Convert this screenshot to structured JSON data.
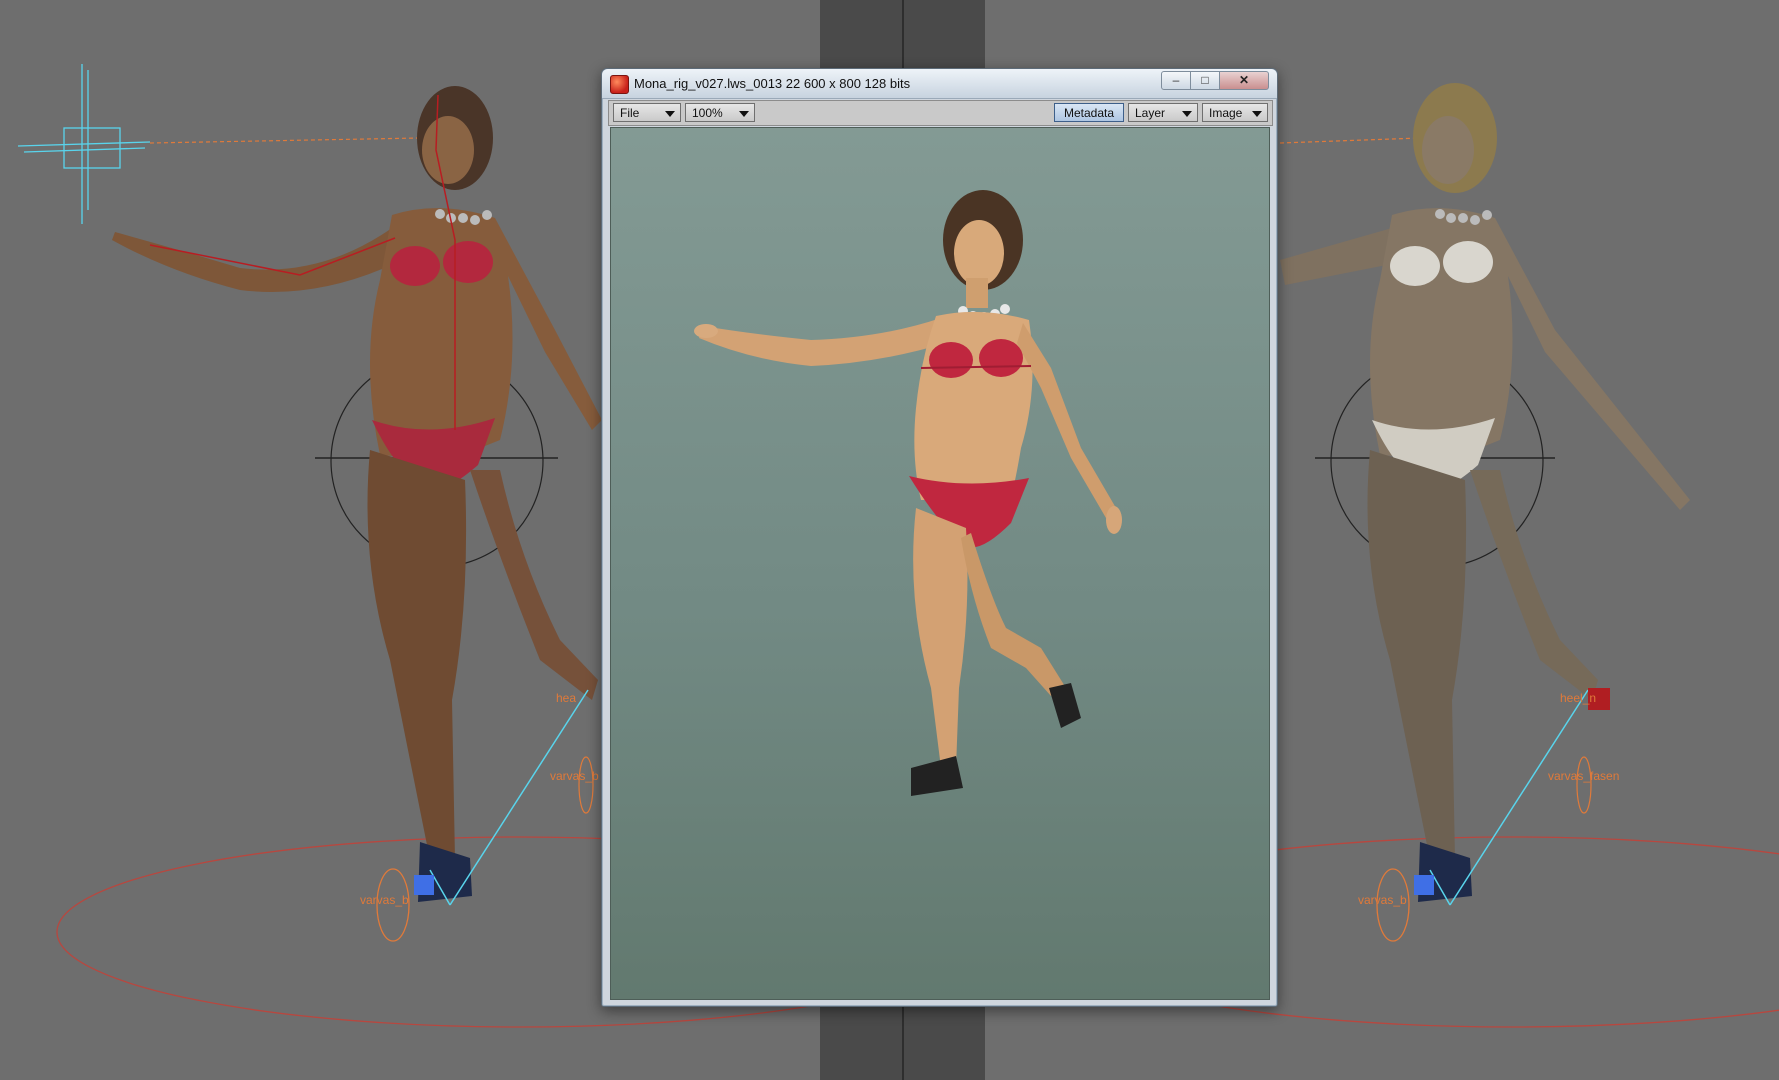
{
  "render_window": {
    "title": "Mona_rig_v027.lws_0013 22  600 x 800 128 bits",
    "minimize_glyph": "–",
    "maximize_glyph": "□",
    "close_glyph": "✕",
    "toolbar": {
      "file_label": "File",
      "zoom_label": "100%",
      "metadata_label": "Metadata",
      "layer_label": "Layer",
      "image_label": "Image"
    }
  },
  "viewport_left": {
    "labels": [
      "hea",
      "varvas_b",
      "varvas_b"
    ]
  },
  "viewport_right": {
    "labels": [
      "heel_n",
      "varvas_fasen",
      "varvas_b"
    ]
  },
  "colors": {
    "viewport_bg": "#6e6e6e",
    "center_strip": "#4a4a4a",
    "bikini_red": "#c0273f",
    "skin": "#c99b6a",
    "rig_cyan": "#59d4ec",
    "rig_orange": "#e07a3a",
    "ground_circle": "#b8473f"
  }
}
